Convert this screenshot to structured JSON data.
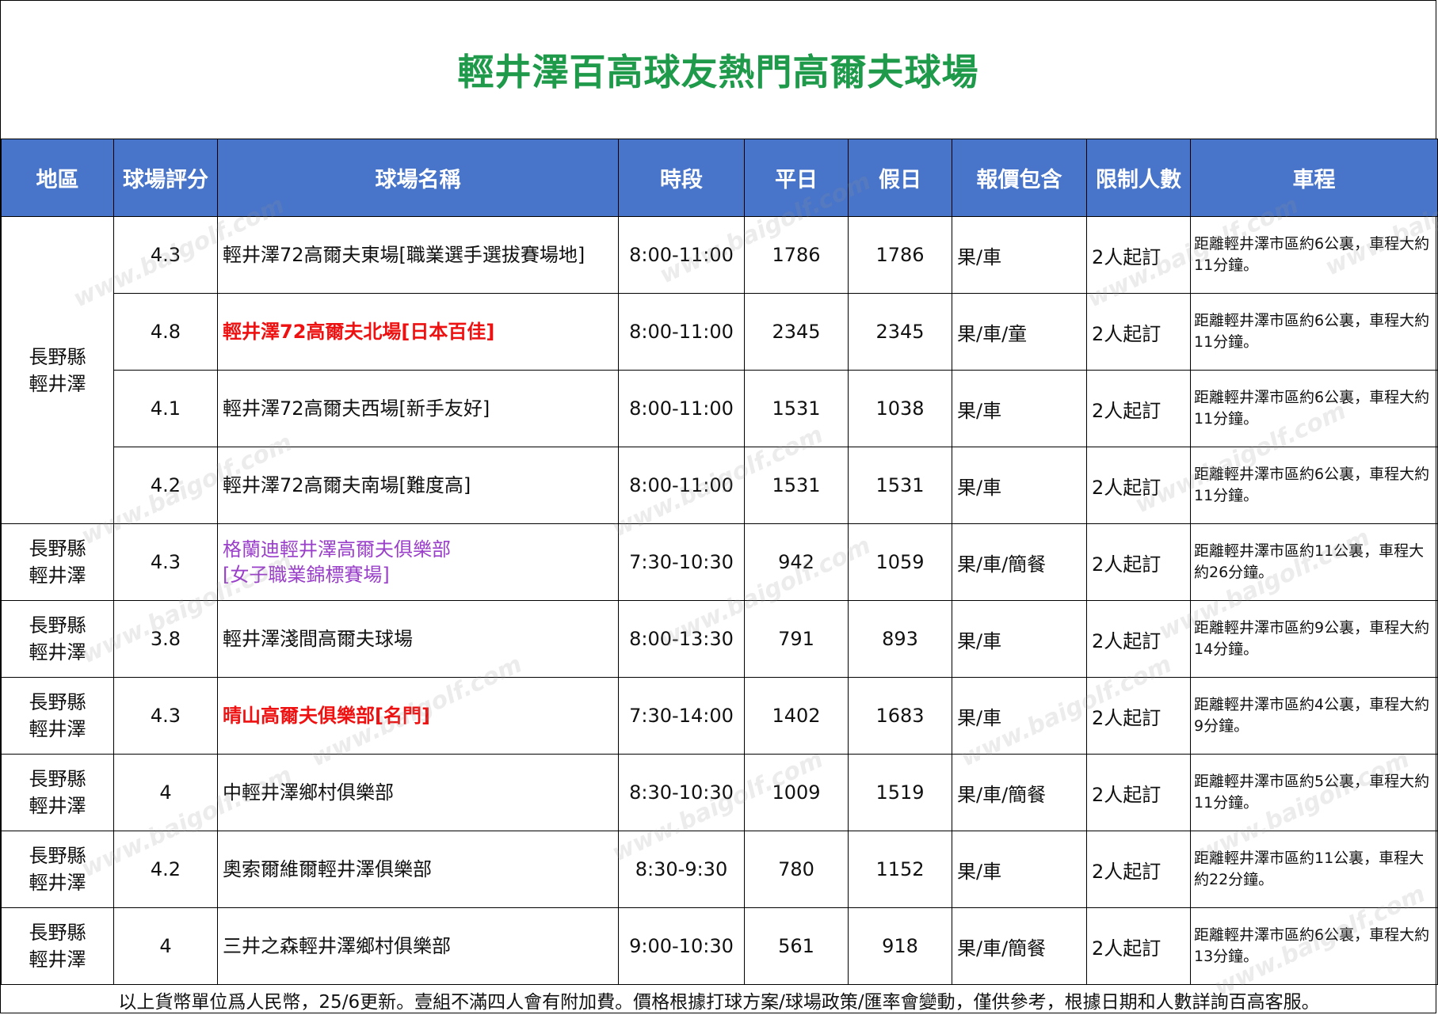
{
  "title": "輕井澤百高球友熱門高爾夫球場",
  "headers": [
    "地區",
    "球場評分",
    "球場名稱",
    "時段",
    "平日",
    "假日",
    "報價包含",
    "限制人數",
    "車程"
  ],
  "group_region": [
    "長野縣",
    "輕井澤"
  ],
  "rows": [
    {
      "region": [
        "長野縣",
        "輕井澤"
      ],
      "rating": "4.3",
      "name": [
        "輕井澤72高爾夫東場[職業選手選拔賽場地]"
      ],
      "style": "normal",
      "time": "8:00-11:00",
      "weekday": "1786",
      "holiday": "1786",
      "includes": "果/車",
      "limit": "2人起訂",
      "drive": "距離輕井澤市區約6公裏，車程大約11分鐘。"
    },
    {
      "region": [
        "長野縣",
        "輕井澤"
      ],
      "rating": "4.8",
      "name": [
        "輕井澤72高爾夫北場[日本百佳]"
      ],
      "style": "red",
      "time": "8:00-11:00",
      "weekday": "2345",
      "holiday": "2345",
      "includes": "果/車/童",
      "limit": "2人起訂",
      "drive": "距離輕井澤市區約6公裏，車程大約11分鐘。"
    },
    {
      "region": [
        "長野縣",
        "輕井澤"
      ],
      "rating": "4.1",
      "name": [
        "輕井澤72高爾夫西場[新手友好]"
      ],
      "style": "normal",
      "time": "8:00-11:00",
      "weekday": "1531",
      "holiday": "1038",
      "includes": "果/車",
      "limit": "2人起訂",
      "drive": "距離輕井澤市區約6公裏，車程大約11分鐘。"
    },
    {
      "region": [
        "長野縣",
        "輕井澤"
      ],
      "rating": "4.2",
      "name": [
        "輕井澤72高爾夫南場[難度高]"
      ],
      "style": "normal",
      "time": "8:00-11:00",
      "weekday": "1531",
      "holiday": "1531",
      "includes": "果/車",
      "limit": "2人起訂",
      "drive": "距離輕井澤市區約6公裏，車程大約11分鐘。"
    },
    {
      "region": [
        "長野縣",
        "輕井澤"
      ],
      "rating": "4.3",
      "name": [
        "格蘭迪輕井澤高爾夫俱樂部",
        "[女子職業錦標賽場]"
      ],
      "style": "purple",
      "time": "7:30-10:30",
      "weekday": "942",
      "holiday": "1059",
      "includes": "果/車/簡餐",
      "limit": "2人起訂",
      "drive": "距離輕井澤市區約11公裏，車程大約26分鐘。"
    },
    {
      "region": [
        "長野縣",
        "輕井澤"
      ],
      "rating": "3.8",
      "name": [
        "輕井澤淺間高爾夫球場"
      ],
      "style": "normal",
      "time": "8:00-13:30",
      "weekday": "791",
      "holiday": "893",
      "includes": "果/車",
      "limit": "2人起訂",
      "drive": "距離輕井澤市區約9公裏，車程大約14分鐘。"
    },
    {
      "region": [
        "長野縣",
        "輕井澤"
      ],
      "rating": "4.3",
      "name": [
        "晴山高爾夫俱樂部[名門]"
      ],
      "style": "red",
      "time": "7:30-14:00",
      "weekday": "1402",
      "holiday": "1683",
      "includes": "果/車",
      "limit": "2人起訂",
      "drive": "距離輕井澤市區約4公裏，車程大約9分鐘。"
    },
    {
      "region": [
        "長野縣",
        "輕井澤"
      ],
      "rating": "4",
      "name": [
        "中輕井澤鄉村俱樂部"
      ],
      "style": "normal",
      "time": "8:30-10:30",
      "weekday": "1009",
      "holiday": "1519",
      "includes": "果/車/簡餐",
      "limit": "2人起訂",
      "drive": "距離輕井澤市區約5公裏，車程大約11分鐘。"
    },
    {
      "region": [
        "長野縣",
        "輕井澤"
      ],
      "rating": "4.2",
      "name": [
        "奧索爾維爾輕井澤俱樂部"
      ],
      "style": "normal",
      "time": "8:30-9:30",
      "weekday": "780",
      "holiday": "1152",
      "includes": "果/車",
      "limit": "2人起訂",
      "drive": "距離輕井澤市區約11公裏，車程大約22分鐘。"
    },
    {
      "region": [
        "長野縣",
        "輕井澤"
      ],
      "rating": "4",
      "name": [
        "三井之森輕井澤鄉村俱樂部"
      ],
      "style": "normal",
      "time": "9:00-10:30",
      "weekday": "561",
      "holiday": "918",
      "includes": "果/車/簡餐",
      "limit": "2人起訂",
      "drive": "距離輕井澤市區約6公裏，車程大約13分鐘。"
    }
  ],
  "footer": "以上貨幣單位爲人民幣，25/6更新。壹組不滿四人會有附加費。價格根據打球方案/球場政策/匯率會變動，僅供參考，根據日期和人數詳詢百高客服。",
  "watermark": "www.baigolf.com",
  "colors": {
    "title": "#1e9a4a",
    "header_bg": "#4874c9",
    "highlight_red": "#ee1111",
    "highlight_purple": "#9a3fc9"
  }
}
